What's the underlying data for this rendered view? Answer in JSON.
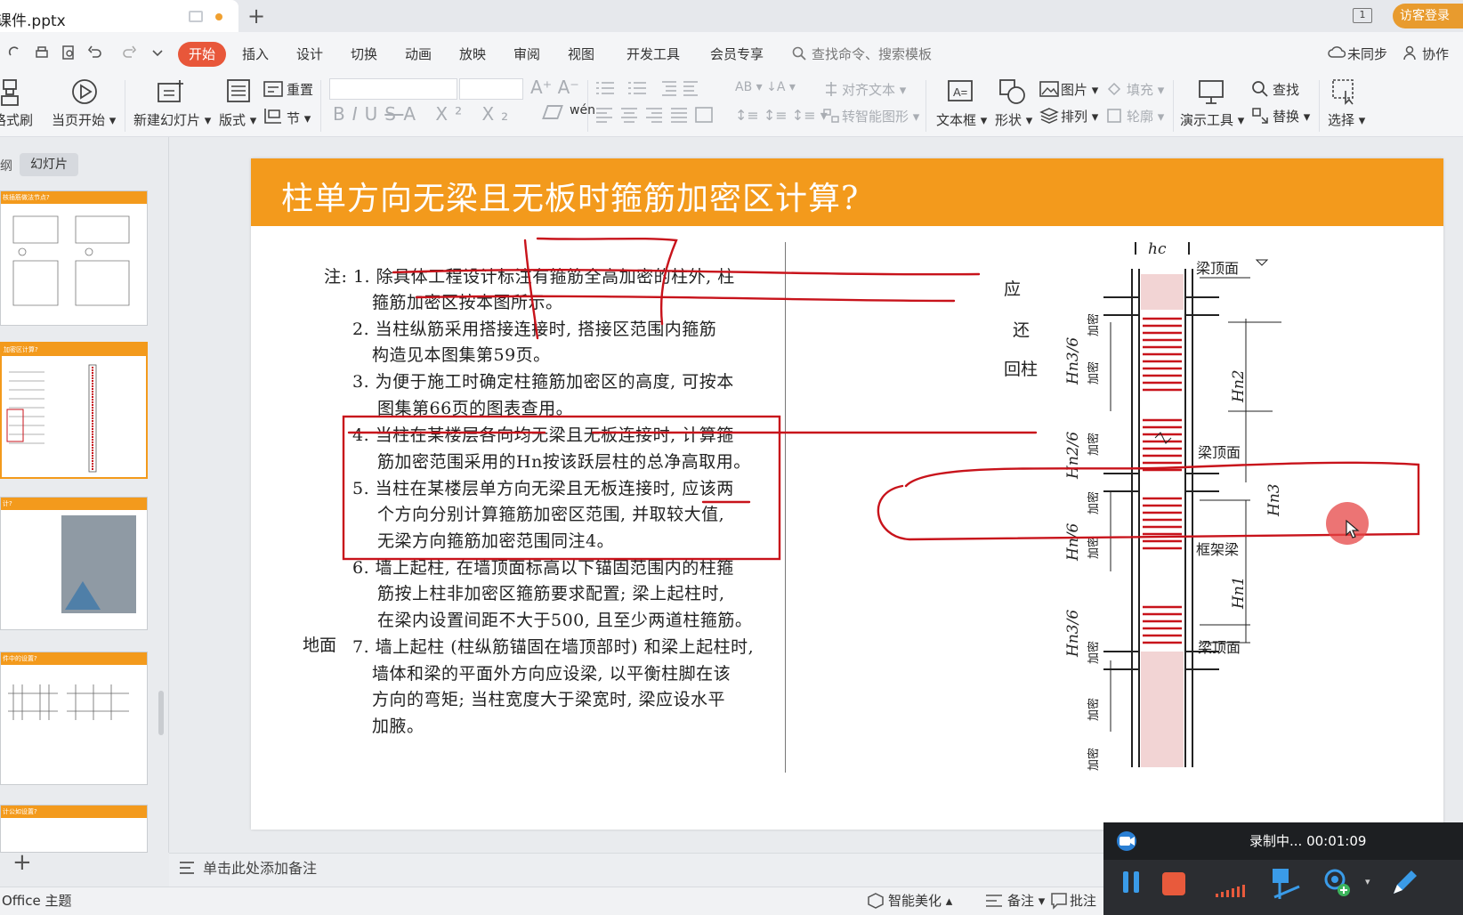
{
  "tabbar": {
    "doc_title": "课件.pptx",
    "login_label": "访客登录",
    "window_count": "1"
  },
  "menu": {
    "items": [
      "开始",
      "插入",
      "设计",
      "切换",
      "动画",
      "放映",
      "审阅",
      "视图",
      "开发工具",
      "会员专享"
    ],
    "search_placeholder": "查找命令、搜索模板",
    "sync_label": "未同步",
    "collab_label": "协作"
  },
  "ribbon": {
    "format_painter": "格式刷",
    "play_from_current": "当页开始",
    "new_slide": "新建幻灯片",
    "layout": "版式",
    "reset": "重置",
    "section": "节",
    "align_text": "对齐文本",
    "convert_smartart": "转智能图形",
    "text_box": "文本框",
    "shape": "形状",
    "picture": "图片",
    "arrange": "排列",
    "fill": "填充",
    "outline": "轮廓",
    "presentation_tools": "演示工具",
    "find": "查找",
    "replace": "替换",
    "select": "选择",
    "pinyin": "wén"
  },
  "left_panel": {
    "tab_outline": "纲",
    "tab_slides": "幻灯片",
    "thumb_titles": [
      "核插筋做法节点?",
      "加密区计算?",
      "计?",
      "件中的设置?",
      "计公如设置?"
    ]
  },
  "slide": {
    "title": "柱单方向无梁且无板时箍筋加密区计算?",
    "notes": [
      "注: 1. 除具体工程设计标注有箍筋全高加密的柱外, 柱",
      "箍筋加密区按本图所示。",
      "2. 当柱纵筋采用搭接连接时, 搭接区范围内箍筋",
      "构造见本图集第59页。",
      "3. 为便于施工时确定柱箍筋加密区的高度, 可按本",
      "图集第66页的图表查用。",
      "4. 当柱在某楼层各向均无梁且无板连接时, 计算箍",
      "筋加密范围采用的Hn按该跃层柱的总净高取用。",
      "5. 当柱在某楼层单方向无梁且无板连接时, 应该两",
      "个方向分别计算箍筋加密区范围, 并取较大值,",
      "无梁方向箍筋加密范围同注4。",
      "6. 墙上起柱, 在墙顶面标高以下锚固范围内的柱箍",
      "筋按上柱非加密区箍筋要求配置; 梁上起柱时,",
      "在梁内设置间距不大于500, 且至少两道柱箍筋。",
      "7. 墙上起柱 (柱纵筋锚固在墙顶部时) 和梁上起柱时,",
      "墙体和梁的平面外方向应设梁, 以平衡柱脚在该",
      "方向的弯矩; 当柱宽度大于梁宽时, 梁应设水平",
      "加腋。"
    ],
    "side_fragments": [
      "应",
      "还",
      "回柱",
      "地面"
    ],
    "diagram": {
      "hc": "hc",
      "beam_top_1": "梁顶面",
      "beam_top_2": "梁顶面",
      "beam_top_3": "梁顶面",
      "frame_beam": "框架梁",
      "hn2": "Hn2",
      "hn3": "Hn3",
      "hn1": "Hn1",
      "hn3_6_top": "Hn3/6",
      "hn2_6": "Hn2/6",
      "hn_6": "Hn/6",
      "hn3_6_bot": "Hn3/6",
      "dense_label": "加密"
    }
  },
  "notes_bar": {
    "placeholder": "单击此处添加备注"
  },
  "statusbar": {
    "theme": "Office 主题",
    "beautify": "智能美化",
    "notes": "备注",
    "comment": "批注"
  },
  "recorder": {
    "status": "录制中... 00:01:09"
  },
  "colors": {
    "accent": "#e8573a",
    "slide_header": "#f39a1c",
    "annotation": "#c8131b",
    "login": "#e89b2e"
  }
}
